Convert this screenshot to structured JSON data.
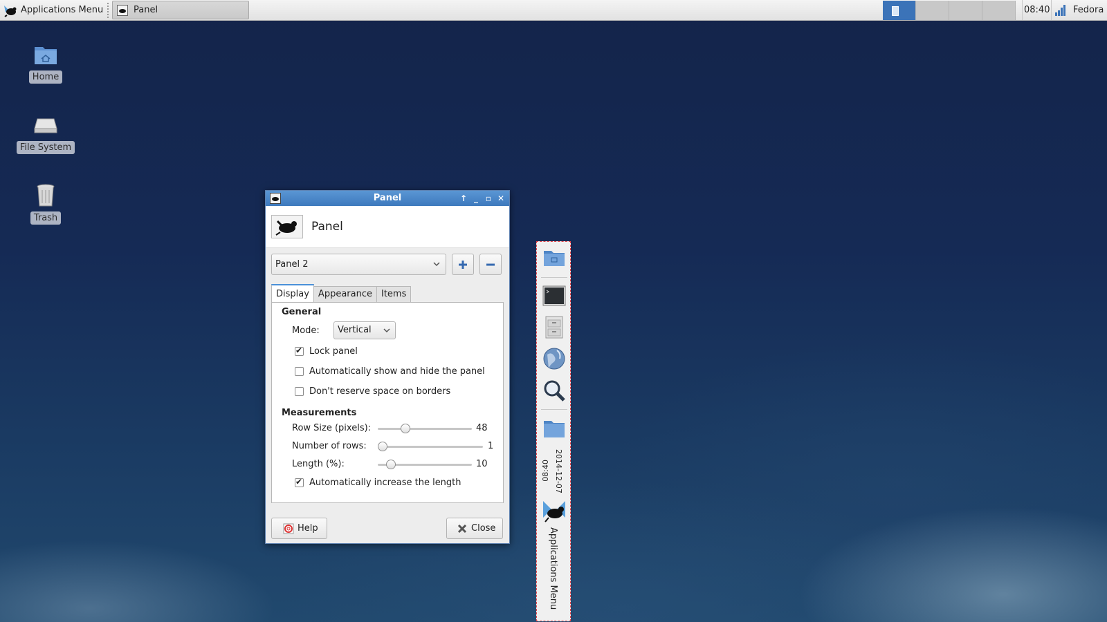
{
  "top_panel": {
    "app_menu_label": "Applications Menu",
    "task_button_label": "Panel",
    "clock": "08:40",
    "user": "Fedora",
    "workspace_count": 4,
    "active_workspace": 1
  },
  "desktop": {
    "icons": [
      {
        "label": "Home",
        "icon": "home-folder-icon"
      },
      {
        "label": "File System",
        "icon": "drive-icon"
      },
      {
        "label": "Trash",
        "icon": "trash-icon"
      }
    ]
  },
  "dialog": {
    "window_title": "Panel",
    "header_title": "Panel",
    "panel_select": "Panel 2",
    "tabs": [
      "Display",
      "Appearance",
      "Items"
    ],
    "active_tab": "Display",
    "general": {
      "title": "General",
      "mode_label": "Mode:",
      "mode_value": "Vertical",
      "lock_panel": {
        "label": "Lock panel",
        "checked": true
      },
      "autohide": {
        "label": "Automatically show and hide the panel",
        "checked": false
      },
      "no_reserve": {
        "label": "Don't reserve space on borders",
        "checked": false
      }
    },
    "measurements": {
      "title": "Measurements",
      "row_size": {
        "label": "Row Size (pixels):",
        "value": "48",
        "fraction": 0.27
      },
      "rows": {
        "label": "Number of rows:",
        "value": "1",
        "fraction": 0.0
      },
      "length": {
        "label": "Length (%):",
        "value": "10",
        "fraction": 0.1
      },
      "auto_length": {
        "label": "Automatically increase the length",
        "checked": true
      }
    },
    "help_label": "Help",
    "close_label": "Close"
  },
  "vertical_panel": {
    "date": "2014-12-07",
    "time": "08:40",
    "app_menu_label": "Applications Menu"
  },
  "colors": {
    "accent": "#3d79bd",
    "panel_border": "#e8474c"
  }
}
